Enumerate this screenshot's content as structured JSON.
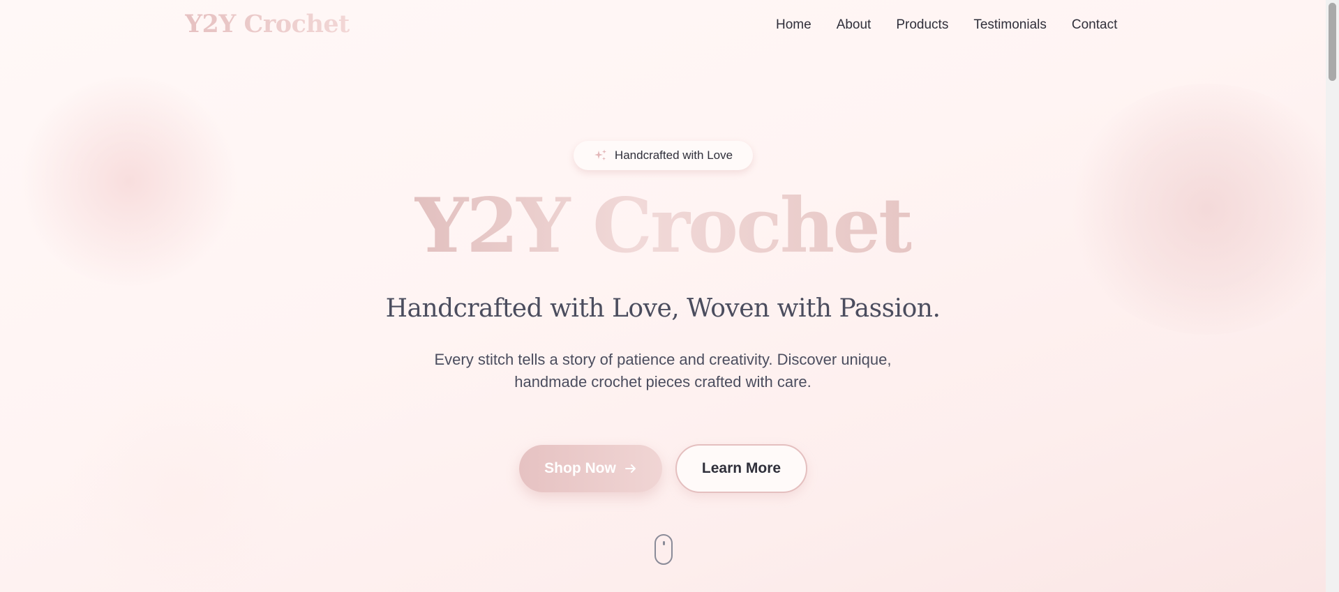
{
  "header": {
    "logo": "Y2Y Crochet",
    "nav": [
      {
        "label": "Home"
      },
      {
        "label": "About"
      },
      {
        "label": "Products"
      },
      {
        "label": "Testimonials"
      },
      {
        "label": "Contact"
      }
    ]
  },
  "hero": {
    "badge": {
      "icon": "sparkles-icon",
      "label": "Handcrafted with Love"
    },
    "title": "Y2Y Crochet",
    "tagline": "Handcrafted with Love, Woven with Passion.",
    "description": "Every stitch tells a story of patience and creativity. Discover unique, handmade crochet pieces crafted with care.",
    "primary_button": {
      "label": "Shop Now",
      "icon": "arrow-right-icon"
    },
    "secondary_button": {
      "label": "Learn More"
    },
    "scroll_indicator": {
      "icon": "mouse-icon"
    }
  },
  "colors": {
    "accent": "#e6c2c2",
    "accent_light": "#f2d7d6",
    "text_dark": "#2f2f3a",
    "text_muted": "#4b4d5e",
    "background": "#fff5f4"
  }
}
